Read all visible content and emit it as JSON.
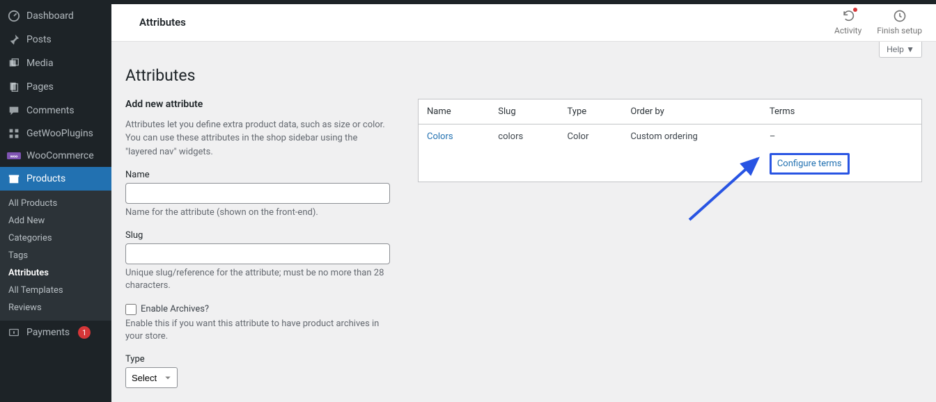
{
  "header": {
    "title": "Attributes"
  },
  "toolbar": {
    "activity_label": "Activity",
    "finish_label": "Finish setup",
    "help_label": "Help ▼"
  },
  "sidebar": {
    "dashboard": "Dashboard",
    "posts": "Posts",
    "media": "Media",
    "pages": "Pages",
    "comments": "Comments",
    "getwoo": "GetWooPlugins",
    "woocommerce": "WooCommerce",
    "products": "Products",
    "payments": "Payments",
    "payments_count": "1",
    "submenu": {
      "all_products": "All Products",
      "add_new": "Add New",
      "categories": "Categories",
      "tags": "Tags",
      "attributes": "Attributes",
      "all_templates": "All Templates",
      "reviews": "Reviews"
    }
  },
  "page": {
    "heading": "Attributes",
    "add_title": "Add new attribute",
    "add_desc": "Attributes let you define extra product data, such as size or color. You can use these attributes in the shop sidebar using the \"layered nav\" widgets.",
    "name_label": "Name",
    "name_help": "Name for the attribute (shown on the front-end).",
    "slug_label": "Slug",
    "slug_help": "Unique slug/reference for the attribute; must be no more than 28 characters.",
    "archives_label": "Enable Archives?",
    "archives_help": "Enable this if you want this attribute to have product archives in your store.",
    "type_label": "Type",
    "type_value": "Select"
  },
  "table": {
    "headers": {
      "name": "Name",
      "slug": "Slug",
      "type": "Type",
      "order": "Order by",
      "terms": "Terms"
    },
    "row": {
      "name": "Colors",
      "slug": "colors",
      "type": "Color",
      "order": "Custom ordering",
      "terms": "–"
    },
    "configure": "Configure terms"
  },
  "form_values": {
    "name": "",
    "slug": ""
  }
}
